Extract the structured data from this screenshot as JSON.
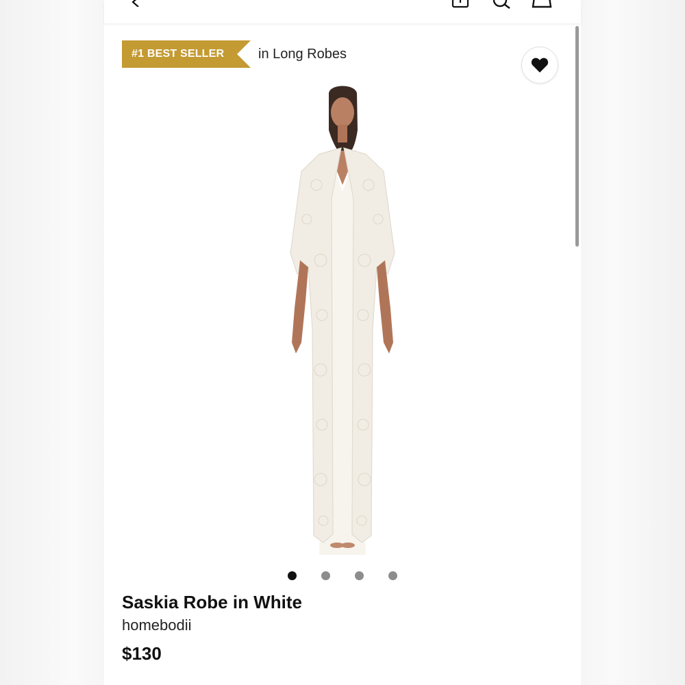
{
  "header": {
    "back_icon": "chevron-left-icon",
    "bag_icon": "shopping-bag-icon",
    "search_icon": "search-icon",
    "cart_icon": "cart-icon"
  },
  "badge": {
    "label": "#1 BEST SELLER",
    "category": "in Long Robes",
    "color": "#C49A32"
  },
  "wishlist_icon": "heart-icon",
  "gallery": {
    "total": 4,
    "active_index": 0
  },
  "product": {
    "name": "Saskia Robe in White",
    "brand": "homebodii",
    "price": "$130"
  }
}
